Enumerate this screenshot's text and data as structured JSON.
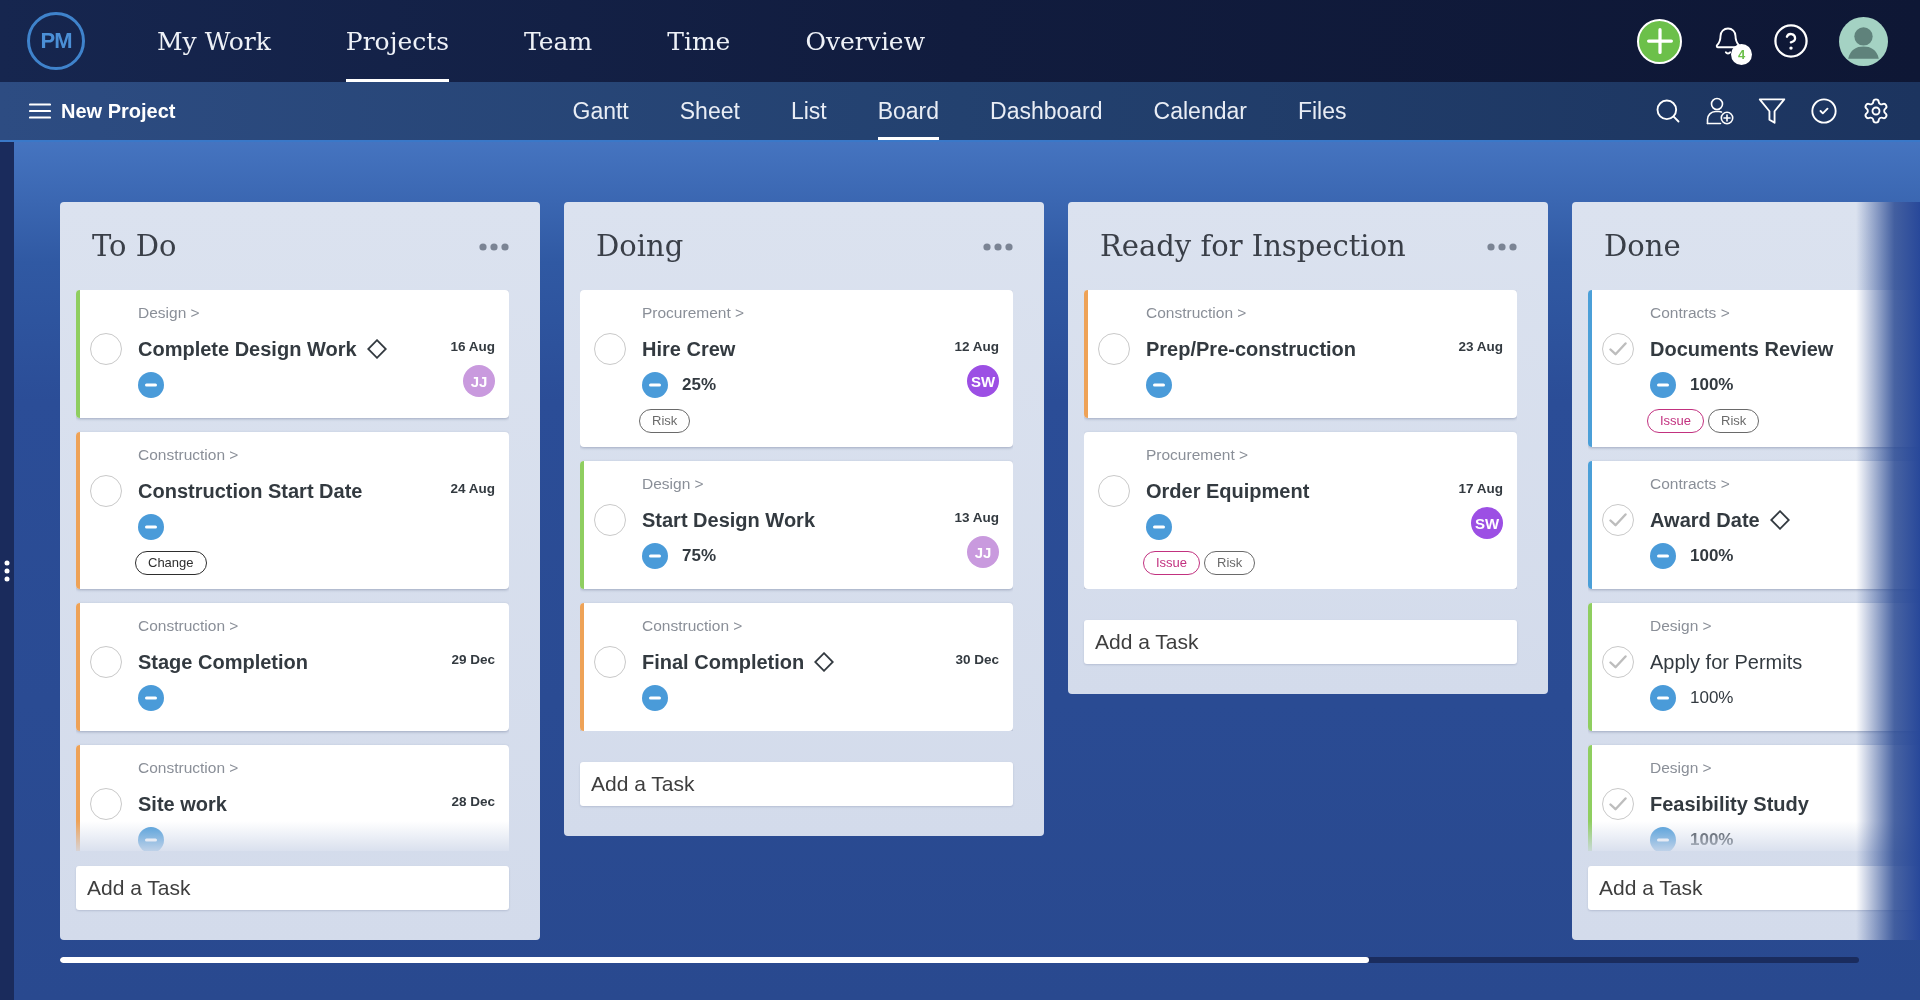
{
  "top_nav": {
    "logo": "PM",
    "items": [
      {
        "label": "My Work",
        "selected": false
      },
      {
        "label": "Projects",
        "selected": true
      },
      {
        "label": "Team",
        "selected": false
      },
      {
        "label": "Time",
        "selected": false
      },
      {
        "label": "Overview",
        "selected": false
      }
    ],
    "notifications_count": "4"
  },
  "project_bar": {
    "project_name": "New Project",
    "tabs": [
      {
        "label": "Gantt",
        "selected": false
      },
      {
        "label": "Sheet",
        "selected": false
      },
      {
        "label": "List",
        "selected": false
      },
      {
        "label": "Board",
        "selected": true
      },
      {
        "label": "Dashboard",
        "selected": false
      },
      {
        "label": "Calendar",
        "selected": false
      },
      {
        "label": "Files",
        "selected": false
      }
    ]
  },
  "columns": [
    {
      "title": "To Do",
      "more_menu": true,
      "scroll_fade": true,
      "cards": [
        {
          "category": "Design >",
          "title": "Complete Design Work",
          "milestone": true,
          "bold": true,
          "checked": false,
          "date": "16 Aug",
          "assignee": {
            "initials": "JJ",
            "color": "#c99ade"
          },
          "color": "#8fce60"
        },
        {
          "category": "Construction >",
          "title": "Construction Start Date",
          "milestone": false,
          "bold": true,
          "checked": false,
          "date": "24 Aug",
          "color": "#eea257",
          "tags": [
            {
              "label": "Change",
              "kind": "change"
            }
          ]
        },
        {
          "category": "Construction >",
          "title": "Stage Completion",
          "milestone": false,
          "bold": true,
          "checked": false,
          "date": "29 Dec",
          "color": "#eea257"
        },
        {
          "category": "Construction >",
          "title": "Site work",
          "milestone": false,
          "bold": true,
          "checked": false,
          "date": "28 Dec",
          "color": "#eea257"
        }
      ],
      "add_task": {
        "placeholder": "Add a Task"
      }
    },
    {
      "title": "Doing",
      "more_menu": true,
      "scroll_fade": false,
      "cards": [
        {
          "category": "Procurement >",
          "title": "Hire Crew",
          "milestone": false,
          "bold": true,
          "checked": false,
          "date": "12 Aug",
          "percent": "25%",
          "assignee": {
            "initials": "SW",
            "color": "#9c4fe4"
          },
          "tags": [
            {
              "label": "Risk",
              "kind": "risk"
            }
          ]
        },
        {
          "category": "Design >",
          "title": "Start Design Work",
          "milestone": false,
          "bold": true,
          "checked": false,
          "date": "13 Aug",
          "percent": "75%",
          "assignee": {
            "initials": "JJ",
            "color": "#c99ade"
          },
          "color": "#8fce60"
        },
        {
          "category": "Construction >",
          "title": "Final Completion",
          "milestone": true,
          "bold": true,
          "checked": false,
          "date": "30 Dec",
          "color": "#eea257"
        }
      ],
      "add_task": {
        "placeholder": "Add a Task"
      }
    },
    {
      "title": "Ready for Inspection",
      "more_menu": true,
      "scroll_fade": false,
      "cards": [
        {
          "category": "Construction >",
          "title": "Prep/Pre-construction",
          "milestone": false,
          "bold": true,
          "checked": false,
          "date": "23 Aug",
          "color": "#eea257"
        },
        {
          "category": "Procurement >",
          "title": "Order Equipment",
          "milestone": false,
          "bold": true,
          "checked": false,
          "date": "17 Aug",
          "assignee": {
            "initials": "SW",
            "color": "#9c4fe4"
          },
          "tags": [
            {
              "label": "Issue",
              "kind": "issue"
            },
            {
              "label": "Risk",
              "kind": "risk"
            }
          ]
        }
      ],
      "add_task": {
        "placeholder": "Add a Task"
      }
    },
    {
      "title": "Done",
      "more_menu": false,
      "scroll_fade": true,
      "cards": [
        {
          "category": "Contracts >",
          "title": "Documents Review",
          "milestone": false,
          "bold": true,
          "checked": true,
          "percent": "100%",
          "color": "#4b9fd8",
          "tags": [
            {
              "label": "Issue",
              "kind": "issue"
            },
            {
              "label": "Risk",
              "kind": "risk"
            }
          ]
        },
        {
          "category": "Contracts >",
          "title": "Award Date",
          "milestone": true,
          "bold": true,
          "checked": true,
          "percent": "100%",
          "color": "#4b9fd8"
        },
        {
          "category": "Design >",
          "title": "Apply for Permits",
          "milestone": false,
          "bold": false,
          "checked": true,
          "percent": "100%",
          "color": "#8fce60"
        },
        {
          "category": "Design >",
          "title": "Feasibility Study",
          "milestone": false,
          "bold": true,
          "checked": true,
          "percent": "100%",
          "color": "#8fce60"
        }
      ],
      "add_task": {
        "placeholder": "Add a Task"
      }
    }
  ]
}
